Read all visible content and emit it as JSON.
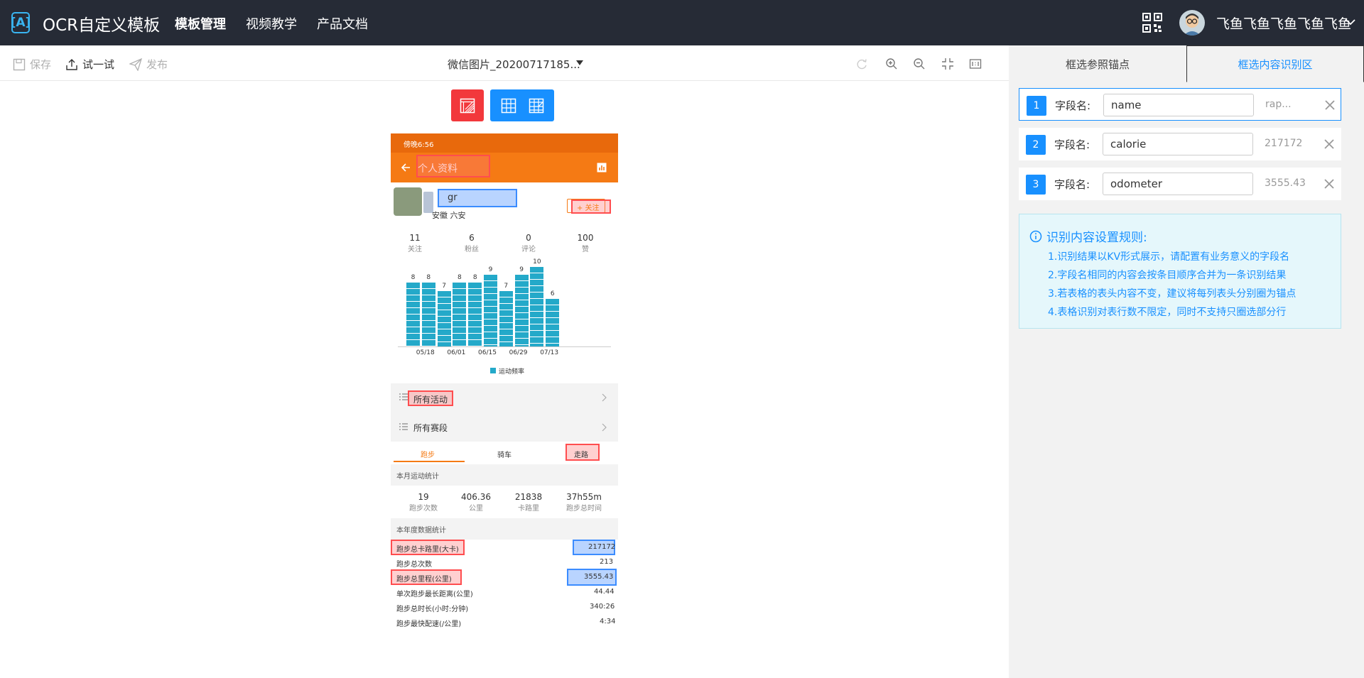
{
  "header": {
    "logo_glyph": "[A]",
    "app_title": "OCR自定义模板",
    "nav": [
      "模板管理",
      "视频教学",
      "产品文档"
    ],
    "username": "飞鱼飞鱼飞鱼飞鱼飞鱼"
  },
  "toolbar": {
    "save_label": "保存",
    "try_label": "试一试",
    "publish_label": "发布",
    "file_name": "微信图片_20200717185..."
  },
  "phone": {
    "status_time": "傍晚6:56",
    "page_title": "个人资料",
    "user_name_partial": "gr",
    "location": "安徽 六安",
    "follow_button": "+ 关注",
    "stats": [
      {
        "value": "11",
        "label": "关注"
      },
      {
        "value": "6",
        "label": "粉丝"
      },
      {
        "value": "0",
        "label": "评论"
      },
      {
        "value": "100",
        "label": "赞"
      }
    ],
    "menu_all_activities": "所有活动",
    "menu_all_races": "所有赛段",
    "sport_tabs": [
      "跑步",
      "骑车",
      "走路"
    ],
    "month_stats_title": "本月运动统计",
    "month_stats": [
      {
        "value": "19",
        "label": "跑步次数"
      },
      {
        "value": "406.36",
        "label": "公里"
      },
      {
        "value": "21838",
        "label": "卡路里"
      },
      {
        "value": "37h55m",
        "label": "跑步总时间"
      }
    ],
    "year_stats_title": "本年度数据统计",
    "year_rows": [
      {
        "label": "跑步总卡路里(大卡)",
        "value": "217172"
      },
      {
        "label": "跑步总次数",
        "value": "213"
      },
      {
        "label": "跑步总里程(公里)",
        "value": "3555.43"
      },
      {
        "label": "单次跑步最长距离(公里)",
        "value": "44.44"
      },
      {
        "label": "跑步总时长(小时:分钟)",
        "value": "340:26"
      },
      {
        "label": "跑步最快配速(/公里)",
        "value": "4:34"
      }
    ]
  },
  "chart_data": {
    "type": "bar",
    "values": [
      8,
      8,
      7,
      8,
      8,
      9,
      7,
      9,
      10,
      6
    ],
    "x_tick_labels": [
      "05/18",
      "06/01",
      "06/15",
      "06/29",
      "07/13"
    ],
    "legend": "运动频率",
    "bar_color": "#24a9c9"
  },
  "right_panel": {
    "tabs": [
      "框选参照锚点",
      "框选内容识别区"
    ],
    "active_tab": 1,
    "field_label": "字段名:",
    "fields": [
      {
        "index": "1",
        "name": "name",
        "value": "rap..."
      },
      {
        "index": "2",
        "name": "calorie",
        "value": "217172"
      },
      {
        "index": "3",
        "name": "odometer",
        "value": "3555.43"
      }
    ],
    "rules_title": "识别内容设置规则:",
    "rules": [
      "1.识别结果以KV形式展示，请配置有业务意义的字段名",
      "2.字段名相同的内容会按条目顺序合并为一条识别结果",
      "3.若表格的表头内容不变，建议将每列表头分别圈为锚点",
      "4.表格识别对表行数不限定，同时不支持只圈选部分行"
    ]
  },
  "colors": {
    "topbar": "#262b36",
    "accent_blue": "#1890ff",
    "tool_red": "#f2383c",
    "phone_orange": "#f57a14"
  }
}
